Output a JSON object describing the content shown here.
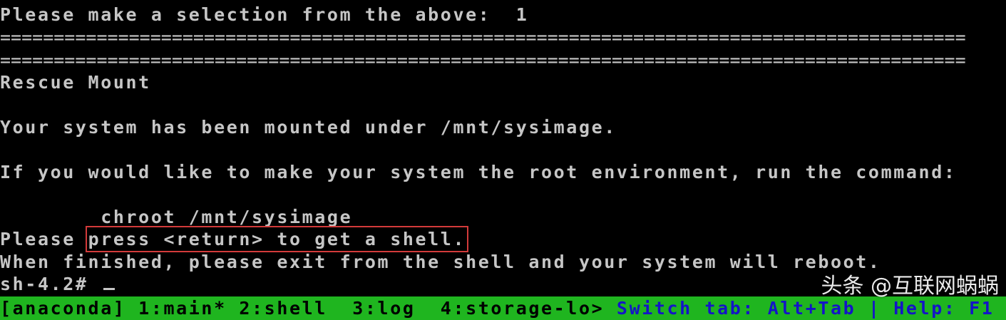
{
  "terminal": {
    "prompt_line": "Please make a selection from the above:  1",
    "separator_1": "==========================================================================================",
    "separator_2": "==========================================================================================",
    "heading": "Rescue Mount",
    "mounted_msg": "Your system has been mounted under /mnt/sysimage.",
    "root_env_msg": "If you would like to make your system the root environment, run the command:",
    "chroot_cmd": "        chroot /mnt/sysimage",
    "press_prefix": "Please ",
    "press_highlight": "press <return> to get a shell.",
    "finished_msg": "When finished, please exit from the shell and your system will reboot.",
    "shell_prompt": "sh-4.2# "
  },
  "statusbar": {
    "tabs_text": "[anaconda] 1:main* 2:shell  3:log  4:storage-lo> ",
    "help_text": "Switch tab: Alt+Tab | Help: F1"
  },
  "watermark": {
    "text": "头条 @互联网蜗蜗"
  },
  "colors": {
    "background": "#000000",
    "text": "#c6c6c6",
    "statusbar_bg": "#1fb51f",
    "statusbar_help": "#1414c8",
    "highlight_box": "#d33a3a"
  }
}
